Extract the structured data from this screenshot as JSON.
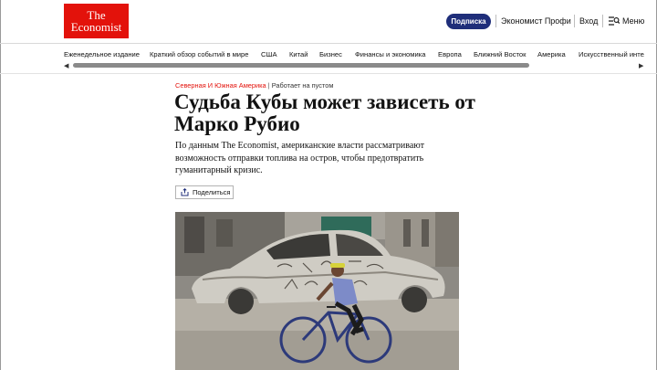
{
  "header": {
    "logo_line1": "The",
    "logo_line2": "Economist",
    "subscribe_label": "Подписка",
    "pro_label": "Экономист Профи",
    "login_label": "Вход",
    "menu_label": "Меню"
  },
  "nav": {
    "items": [
      "Еженедельное издание",
      "Краткий обзор событий в мире",
      "США",
      "Китай",
      "Бизнес",
      "Финансы и экономика",
      "Европа",
      "Ближний Восток",
      "Америка",
      "Искусственный интеллект"
    ],
    "scroll_left": "◀",
    "scroll_right": "▶"
  },
  "article": {
    "section": "Северная И Южная Америка",
    "separator": "|",
    "tag": "Работает на пустом",
    "headline": "Судьба Кубы может зависеть от Марко Рубио",
    "standfirst": "По данным The Economist, американские власти рассматривают возможность отправки топлива на остров, чтобы предотвратить гуманитарный кризис.",
    "share_label": "Поделиться"
  },
  "colors": {
    "brand_red": "#e3120b",
    "subscribe_blue": "#1f2e7a"
  }
}
